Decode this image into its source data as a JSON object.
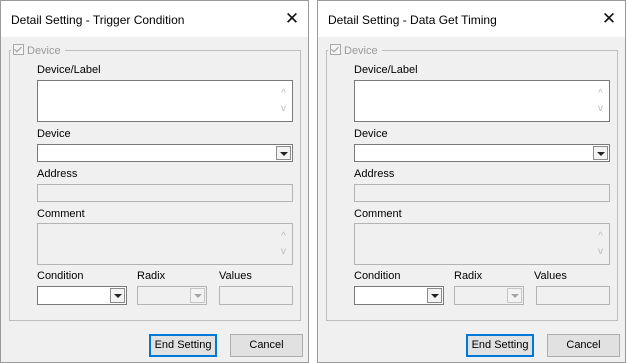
{
  "dialogs": [
    {
      "title": "Detail Setting - Trigger Condition",
      "close_glyph": "✕",
      "group_label": "Device",
      "group_checked": true,
      "device_label_caption": "Device/Label",
      "device_caption": "Device",
      "device_value": "",
      "address_caption": "Address",
      "comment_caption": "Comment",
      "condition_caption": "Condition",
      "radix_caption": "Radix",
      "values_caption": "Values",
      "end_setting_label": "End Setting",
      "cancel_label": "Cancel"
    },
    {
      "title": "Detail Setting - Data Get Timing",
      "close_glyph": "✕",
      "group_label": "Device",
      "group_checked": true,
      "device_label_caption": "Device/Label",
      "device_caption": "Device",
      "device_value": "",
      "address_caption": "Address",
      "comment_caption": "Comment",
      "condition_caption": "Condition",
      "radix_caption": "Radix",
      "values_caption": "Values",
      "end_setting_label": "End Setting",
      "cancel_label": "Cancel"
    }
  ],
  "icons": {
    "close": "close-icon",
    "scroll_up": "chevron-up-icon",
    "scroll_down": "chevron-down-icon",
    "dropdown": "dropdown-arrow-icon",
    "checkbox": "checkbox-checked-icon"
  },
  "colors": {
    "dialog_bg": "#f0f0f0",
    "titlebar_bg": "#ffffff",
    "default_button_border": "#0078d7",
    "disabled_text": "#9a9a9a"
  }
}
